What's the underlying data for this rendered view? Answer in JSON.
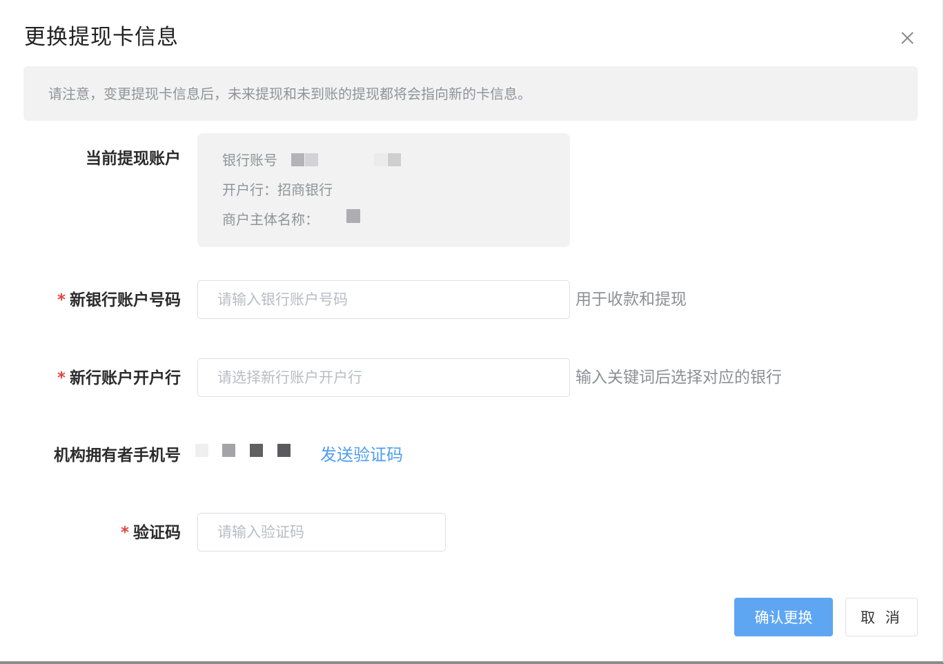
{
  "dialog": {
    "title": "更换提现卡信息",
    "close_icon": "close-icon"
  },
  "notice": {
    "text": "请注意，变更提现卡信息后，未来提现和未到账的提现都将会指向新的卡信息。"
  },
  "current_account": {
    "label": "当前提现账户",
    "bank_account_label": "银行账号",
    "opening_bank_text": "开户行：招商银行",
    "merchant_name_label": "商户主体名称："
  },
  "new_account_number": {
    "required_mark": "*",
    "label": "新银行账户号码",
    "placeholder": "请输入银行账户号码",
    "hint": "用于收款和提现"
  },
  "new_opening_bank": {
    "required_mark": "*",
    "label": "新行账户开户行",
    "placeholder": "请选择新行账户开户行",
    "hint": "输入关键词后选择对应的银行"
  },
  "owner_phone": {
    "label": "机构拥有者手机号",
    "send_code_label": "发送验证码"
  },
  "verification_code": {
    "required_mark": "*",
    "label": "验证码",
    "placeholder": "请输入验证码"
  },
  "footer": {
    "confirm_label": "确认更换",
    "cancel_label": "取 消"
  },
  "colors": {
    "primary": "#5fa6f2",
    "link": "#4f9cf0",
    "required": "#e2463d",
    "notice_bg": "#f2f2f2"
  }
}
